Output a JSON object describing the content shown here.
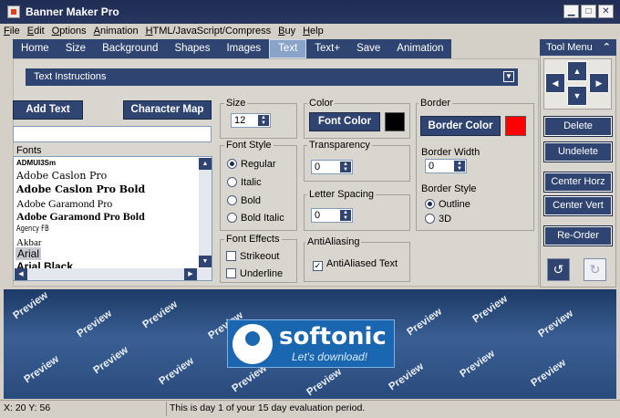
{
  "window": {
    "title": "Banner Maker Pro",
    "minimize": "▁",
    "maximize": "□",
    "close": "✕"
  },
  "menu": [
    "File",
    "Edit",
    "Options",
    "Animation",
    "HTML/JavaScript/Compress",
    "Buy",
    "Help"
  ],
  "tabs": [
    {
      "label": "Home",
      "active": false
    },
    {
      "label": "Size",
      "active": false
    },
    {
      "label": "Background",
      "active": false
    },
    {
      "label": "Shapes",
      "active": false
    },
    {
      "label": "Images",
      "active": false
    },
    {
      "label": "Text",
      "active": true
    },
    {
      "label": "Text+",
      "active": false
    },
    {
      "label": "Save",
      "active": false
    },
    {
      "label": "Animation",
      "active": false
    }
  ],
  "instructions": {
    "label": "Text Instructions"
  },
  "buttons": {
    "add_text": "Add Text",
    "character_map": "Character Map"
  },
  "text_input": {
    "value": ""
  },
  "fonts": {
    "legend": "Fonts",
    "items": [
      "ADMUI3Sm",
      "Adobe Caslon Pro",
      "Adobe Caslon Pro Bold",
      "Adobe Garamond Pro",
      "Adobe Garamond Pro Bold",
      "Agency FB",
      "Akbar",
      "Arial",
      "Arial Black"
    ],
    "selected": "Arial"
  },
  "size": {
    "legend": "Size",
    "value": "12"
  },
  "font_style": {
    "legend": "Font Style",
    "options": [
      "Regular",
      "Italic",
      "Bold",
      "Bold Italic"
    ],
    "selected": "Regular"
  },
  "font_effects": {
    "legend": "Font Effects",
    "strikeout": "Strikeout",
    "underline": "Underline"
  },
  "color": {
    "legend": "Color",
    "button": "Font Color",
    "swatch": "#000000"
  },
  "transparency": {
    "legend": "Transparency",
    "value": "0"
  },
  "letter_spacing": {
    "legend": "Letter Spacing",
    "value": "0"
  },
  "antialiasing": {
    "legend": "AntiAliasing",
    "label": "AntiAliased Text",
    "checked": true
  },
  "border": {
    "legend": "Border",
    "button": "Border Color",
    "swatch": "#ff0000",
    "width_label": "Border Width",
    "width_value": "0",
    "style_label": "Border Style",
    "style_options": [
      "Outline",
      "3D"
    ],
    "style_selected": "Outline"
  },
  "tool_menu": {
    "title": "Tool Menu",
    "collapse": "⌃",
    "buttons": [
      "Delete",
      "Undelete",
      "Center Horz",
      "Center Vert",
      "Re-Order"
    ],
    "arrow_up": "▲",
    "arrow_down": "▼",
    "arrow_left": "◀",
    "arrow_right": "▶",
    "undo": "↺",
    "redo": "↻"
  },
  "preview": {
    "watermark": "Preview",
    "logo_brand": "softonic",
    "logo_tagline": "Let's download!"
  },
  "status": {
    "coords": "X: 20  Y: 56",
    "message": "This is day 1 of your 15 day evaluation period."
  },
  "colors": {
    "navy": "#2f4471",
    "title_bar": "#1f2d55",
    "panel": "#d9d6cf"
  }
}
